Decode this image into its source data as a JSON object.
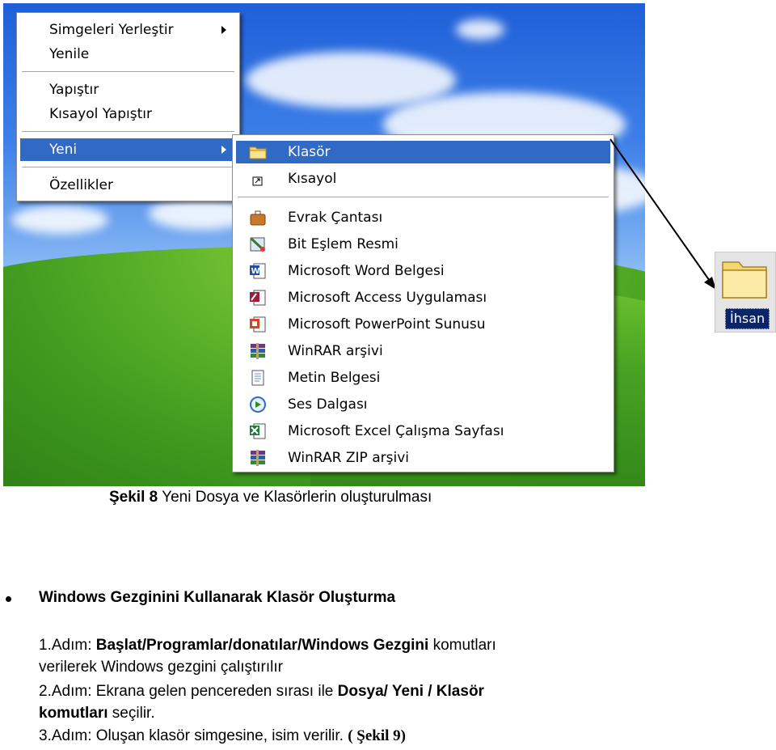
{
  "context_menu": {
    "items": [
      {
        "label": "Simgeleri Yerleştir",
        "has_submenu": true
      },
      {
        "label": "Yenile"
      },
      {
        "label": "Yapıştır"
      },
      {
        "label": "Kısayol Yapıştır"
      },
      {
        "label": "Yeni",
        "has_submenu": true,
        "selected": true
      },
      {
        "label": "Özellikler"
      }
    ]
  },
  "new_submenu": {
    "items": [
      {
        "label": "Klasör",
        "icon": "folder-icon",
        "selected": true
      },
      {
        "label": "Kısayol",
        "icon": "shortcut-icon"
      },
      {
        "label": "Evrak Çantası",
        "icon": "briefcase-icon"
      },
      {
        "label": "Bit Eşlem Resmi",
        "icon": "bitmap-icon"
      },
      {
        "label": "Microsoft Word Belgesi",
        "icon": "word-icon"
      },
      {
        "label": "Microsoft Access Uygulaması",
        "icon": "access-icon"
      },
      {
        "label": "Microsoft PowerPoint Sunusu",
        "icon": "powerpoint-icon"
      },
      {
        "label": "WinRAR arşivi",
        "icon": "winrar-icon"
      },
      {
        "label": "Metin Belgesi",
        "icon": "text-document-icon"
      },
      {
        "label": "Ses Dalgası",
        "icon": "sound-wave-icon"
      },
      {
        "label": "Microsoft Excel Çalışma Sayfası",
        "icon": "excel-icon"
      },
      {
        "label": "WinRAR ZIP arşivi",
        "icon": "winrar-zip-icon"
      }
    ]
  },
  "desktop_folder": {
    "label": "İhsan",
    "icon": "folder-icon"
  },
  "colors": {
    "selection": "#316ac5",
    "menu_bg": "#ffffff",
    "label_highlight": "#0a246a"
  },
  "caption": {
    "bold": "Şekil 8",
    "text": " Yeni Dosya ve Klasörlerin oluşturulması"
  },
  "section_heading": "Windows Gezginini Kullanarak Klasör Oluşturma",
  "steps": {
    "s1_prefix": "1.Adım: ",
    "s1_bold": "Başlat/Programlar/donatılar/Windows Gezgini",
    "s1_suffix": " komutları",
    "s1_line2": "verilerek Windows gezgini çalıştırılır",
    "s2_prefix": "2.Adım: Ekrana gelen pencereden sırası ile ",
    "s2_bold": "Dosya/ Yeni / Klasör",
    "s2_line2_bold": "komutları",
    "s2_line2_suffix": " seçilir.",
    "s3_prefix": "3.Adım: Oluşan klasör simgesine, isim verilir. ",
    "s3_ref": "( Şekil 9)"
  }
}
